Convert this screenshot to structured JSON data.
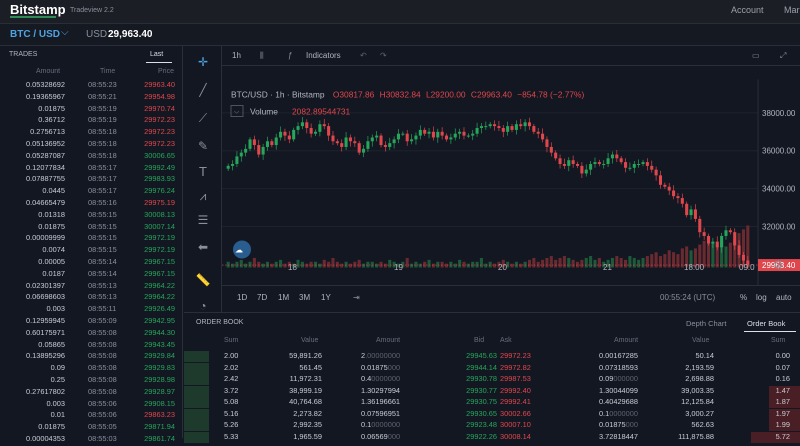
{
  "header": {
    "logo": "Bitstamp",
    "subtitle": "Tradeview 2.2",
    "nav": [
      "Account",
      "Mar"
    ]
  },
  "pairbar": {
    "pair": "BTC / USD",
    "currency": "USD",
    "price": "29,963.40"
  },
  "trades": {
    "title": "TRADES",
    "tab_last": "Last",
    "columns": [
      "Amount",
      "Time",
      "Price"
    ],
    "rows": [
      {
        "amount": "0.05328692",
        "time": "08:55:23",
        "price": "29963.40",
        "side": "dn"
      },
      {
        "amount": "0.19365967",
        "time": "08:55:21",
        "price": "29954.98",
        "side": "dn"
      },
      {
        "amount": "0.01875",
        "time": "08:55:19",
        "price": "29970.74",
        "side": "dn"
      },
      {
        "amount": "0.36712",
        "time": "08:55:19",
        "price": "29972.23",
        "side": "dn"
      },
      {
        "amount": "0.2756713",
        "time": "08:55:18",
        "price": "29972.23",
        "side": "dn"
      },
      {
        "amount": "0.05136952",
        "time": "08:55:18",
        "price": "29972.23",
        "side": "dn"
      },
      {
        "amount": "0.05287087",
        "time": "08:55:18",
        "price": "30006.65",
        "side": "up"
      },
      {
        "amount": "0.12077834",
        "time": "08:55:17",
        "price": "29992.49",
        "side": "up"
      },
      {
        "amount": "0.07887755",
        "time": "08:55:17",
        "price": "29983.93",
        "side": "up"
      },
      {
        "amount": "0.0445",
        "time": "08:55:17",
        "price": "29976.24",
        "side": "up"
      },
      {
        "amount": "0.04665479",
        "time": "08:55:16",
        "price": "29975.19",
        "side": "dn"
      },
      {
        "amount": "0.01318",
        "time": "08:55:15",
        "price": "30008.13",
        "side": "up"
      },
      {
        "amount": "0.01875",
        "time": "08:55:15",
        "price": "30007.14",
        "side": "up"
      },
      {
        "amount": "0.00009999",
        "time": "08:55:15",
        "price": "29972.19",
        "side": "up"
      },
      {
        "amount": "0.0074",
        "time": "08:55:15",
        "price": "29972.19",
        "side": "up"
      },
      {
        "amount": "0.00005",
        "time": "08:55:14",
        "price": "29967.15",
        "side": "up"
      },
      {
        "amount": "0.0187",
        "time": "08:55:14",
        "price": "29967.15",
        "side": "up"
      },
      {
        "amount": "0.02301397",
        "time": "08:55:13",
        "price": "29964.22",
        "side": "up"
      },
      {
        "amount": "0.06698603",
        "time": "08:55:13",
        "price": "29964.22",
        "side": "up"
      },
      {
        "amount": "0.003",
        "time": "08:55:11",
        "price": "29926.49",
        "side": "up"
      },
      {
        "amount": "0.12959945",
        "time": "08:55:09",
        "price": "29942.95",
        "side": "up"
      },
      {
        "amount": "0.60175971",
        "time": "08:55:08",
        "price": "29944.30",
        "side": "up"
      },
      {
        "amount": "0.05865",
        "time": "08:55:08",
        "price": "29943.45",
        "side": "up"
      },
      {
        "amount": "0.13895296",
        "time": "08:55:08",
        "price": "29929.84",
        "side": "up"
      },
      {
        "amount": "0.09",
        "time": "08:55:08",
        "price": "29929.83",
        "side": "up"
      },
      {
        "amount": "0.25",
        "time": "08:55:08",
        "price": "29928.98",
        "side": "up"
      },
      {
        "amount": "0.27617802",
        "time": "08:55:08",
        "price": "29928.97",
        "side": "up"
      },
      {
        "amount": "0.003",
        "time": "08:55:06",
        "price": "29908.15",
        "side": "up"
      },
      {
        "amount": "0.01",
        "time": "08:55:06",
        "price": "29863.23",
        "side": "dn"
      },
      {
        "amount": "0.01875",
        "time": "08:55:05",
        "price": "29871.94",
        "side": "up"
      },
      {
        "amount": "0.00004353",
        "time": "08:55:03",
        "price": "29861.74",
        "side": "up"
      }
    ]
  },
  "chart_toolbar": {
    "interval": "1h",
    "indicators": "Indicators"
  },
  "chart_data": {
    "type": "candlestick",
    "legend": {
      "symbol": "BTC/USD · 1h · Bitstamp",
      "open": "O30817.86",
      "high": "H30832.84",
      "low": "L29200.00",
      "close": "C29963.40",
      "change": "−854.78 (−2.77%)"
    },
    "volume": {
      "label": "Volume",
      "value": "2082.89544731"
    },
    "price_axis": [
      38000,
      36000,
      34000,
      32000
    ],
    "price_axis_labels": [
      "38000.00",
      "36000.00",
      "34000.00",
      "32000.00"
    ],
    "ylim": [
      29200,
      38600
    ],
    "current_price": "29963.40",
    "current_price_value": 29963.4,
    "time_axis": [
      "18",
      "19",
      "20",
      "21",
      "18:00",
      "09:0"
    ],
    "closes": [
      35200,
      35300,
      35700,
      35900,
      36100,
      36600,
      36300,
      35800,
      36200,
      36500,
      36300,
      36700,
      37000,
      36800,
      36600,
      37100,
      37300,
      37500,
      37200,
      36900,
      37000,
      37400,
      37300,
      36800,
      36500,
      36400,
      36200,
      36700,
      36500,
      36400,
      35900,
      36100,
      36500,
      36700,
      36800,
      36300,
      36200,
      36400,
      36600,
      36900,
      36900,
      36500,
      36600,
      36800,
      37100,
      36900,
      37000,
      36700,
      37000,
      36800,
      36600,
      36700,
      36900,
      37000,
      36800,
      36800,
      36900,
      37200,
      37300,
      37300,
      37400,
      37300,
      37200,
      37000,
      37300,
      37100,
      37400,
      37300,
      37500,
      37300,
      37000,
      36900,
      36600,
      36200,
      35900,
      35600,
      35300,
      35200,
      35500,
      35300,
      35200,
      34800,
      35000,
      35300,
      35400,
      35300,
      35300,
      35600,
      35800,
      35600,
      35400,
      35100,
      35100,
      35300,
      35300,
      35400,
      35200,
      35000,
      34700,
      34200,
      34100,
      33900,
      33600,
      33500,
      33200,
      32600,
      32900,
      32400,
      31700,
      31500,
      31100,
      31200,
      30900,
      31500,
      31800,
      31700,
      31000,
      30500,
      30200,
      29963
    ],
    "volumes": [
      3,
      2,
      3,
      4,
      2,
      3,
      5,
      3,
      2,
      3,
      2,
      3,
      4,
      2,
      3,
      2,
      4,
      3,
      2,
      3,
      3,
      2,
      4,
      3,
      5,
      3,
      2,
      3,
      2,
      3,
      4,
      2,
      3,
      3,
      2,
      3,
      2,
      4,
      3,
      2,
      3,
      5,
      2,
      3,
      2,
      3,
      4,
      2,
      3,
      3,
      2,
      3,
      2,
      4,
      3,
      2,
      3,
      3,
      5,
      2,
      3,
      2,
      3,
      4,
      3,
      2,
      3,
      2,
      3,
      4,
      5,
      3,
      4,
      5,
      6,
      4,
      5,
      6,
      5,
      4,
      3,
      4,
      5,
      6,
      4,
      5,
      3,
      4,
      5,
      6,
      5,
      4,
      6,
      5,
      4,
      5,
      6,
      7,
      8,
      6,
      7,
      9,
      8,
      7,
      10,
      11,
      9,
      10,
      12,
      14,
      16,
      13,
      12,
      14,
      11,
      13,
      15,
      18,
      20,
      22
    ]
  },
  "timebar": {
    "ranges": [
      "1D",
      "7D",
      "1M",
      "3M",
      "1Y"
    ],
    "clock": "00:55:24 (UTC)",
    "percent": "%",
    "log": "log",
    "auto": "auto"
  },
  "orderbook": {
    "title": "ORDER BOOK",
    "tab_depth": "Depth Chart",
    "tab_book": "Order Book",
    "columns": [
      "Sum",
      "Value",
      "Amount",
      "Bid",
      "Ask",
      "Amount",
      "Value",
      "Sum"
    ],
    "rows": [
      {
        "bsum": "2.00",
        "bvalue": "59,891.26",
        "bamt_main": "2",
        "bamt_dim": ".00000000",
        "bid": "29945.63",
        "ask": "29972.23",
        "aamt_main": "0.00167285",
        "aamt_dim": "",
        "avalue": "50.14",
        "asum": "0.00",
        "bfill": 0.04,
        "afill": 0.0
      },
      {
        "bsum": "2.02",
        "bvalue": "561.45",
        "bamt_main": "0.01875",
        "bamt_dim": "000",
        "bid": "29944.14",
        "ask": "29972.82",
        "aamt_main": "0.07318593",
        "aamt_dim": "",
        "avalue": "2,193.59",
        "asum": "0.07",
        "bfill": 0.04,
        "afill": 0.0
      },
      {
        "bsum": "2.42",
        "bvalue": "11,972.31",
        "bamt_main": "0.4",
        "bamt_dim": "0000000",
        "bid": "29930.78",
        "ask": "29987.53",
        "aamt_main": "0.09",
        "aamt_dim": "000000",
        "avalue": "2,698.88",
        "asum": "0.16",
        "bfill": 0.04,
        "afill": 0.0
      },
      {
        "bsum": "3.72",
        "bvalue": "38,999.19",
        "bamt_main": "1.30297994",
        "bamt_dim": "",
        "bid": "29930.77",
        "ask": "29992.40",
        "aamt_main": "1.30044099",
        "aamt_dim": "",
        "avalue": "39,003.35",
        "asum": "1.47",
        "bfill": 0.04,
        "afill": 0.05
      },
      {
        "bsum": "5.08",
        "bvalue": "40,764.68",
        "bamt_main": "1.36196661",
        "bamt_dim": "",
        "bid": "29930.75",
        "ask": "29992.41",
        "aamt_main": "0.40429688",
        "aamt_dim": "",
        "avalue": "12,125.84",
        "asum": "1.87",
        "bfill": 0.04,
        "afill": 0.05
      },
      {
        "bsum": "5.16",
        "bvalue": "2,273.82",
        "bamt_main": "0.07596951",
        "bamt_dim": "",
        "bid": "29930.65",
        "ask": "30002.66",
        "aamt_main": "0.1",
        "aamt_dim": "0000000",
        "avalue": "3,000.27",
        "asum": "1.97",
        "bfill": 0.04,
        "afill": 0.05
      },
      {
        "bsum": "5.26",
        "bvalue": "2,992.35",
        "bamt_main": "0.1",
        "bamt_dim": "0000000",
        "bid": "29923.48",
        "ask": "30007.10",
        "aamt_main": "0.01875",
        "aamt_dim": "000",
        "avalue": "562.63",
        "asum": "1.99",
        "bfill": 0.04,
        "afill": 0.05
      },
      {
        "bsum": "5.33",
        "bvalue": "1,965.59",
        "bamt_main": "0.06569",
        "bamt_dim": "000",
        "bid": "29922.26",
        "ask": "30008.14",
        "aamt_main": "3.72818447",
        "aamt_dim": "",
        "avalue": "111,875.88",
        "asum": "5.72",
        "bfill": 0.04,
        "afill": 0.08
      }
    ]
  }
}
